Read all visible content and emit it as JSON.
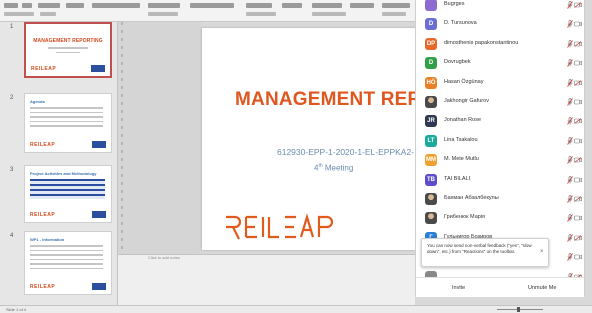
{
  "slides": [
    {
      "number": "1",
      "title": "MANAGEMENT REPORTING",
      "logo": "REILEAP"
    },
    {
      "number": "2",
      "heading": "Agenda",
      "logo": "REILEAP"
    },
    {
      "number": "3",
      "heading": "Project Activities and Methodology",
      "logo": "REILEAP"
    },
    {
      "number": "4",
      "heading": "WP1 - Information",
      "logo": "REILEAP"
    }
  ],
  "slide": {
    "title": "MANAGEMENT REP",
    "project_code": "612930-EPP-1-2020-1-EL-EPPKA2-",
    "meeting_num": "4",
    "meeting_sup": "th",
    "meeting_word": "Meeting",
    "logo": "REILEAP"
  },
  "notes": {
    "placeholder": "Click to add notes"
  },
  "participants": [
    {
      "name": "Bugrges",
      "initials": "",
      "avatar_color": "#8e6bd1",
      "mic": "muted",
      "cam": "off"
    },
    {
      "name": "D. Tursunova",
      "initials": "D",
      "avatar_color": "#6b6fd4",
      "mic": "muted",
      "cam": "off"
    },
    {
      "name": "dimosthenis papakonstantinou",
      "initials": "DP",
      "avatar_color": "#e8692a",
      "mic": "muted",
      "cam": "off"
    },
    {
      "name": "Dovrugbek",
      "initials": "D",
      "avatar_color": "#33a047",
      "mic": "muted",
      "cam": "off"
    },
    {
      "name": "Hasan Özgünay",
      "initials": "HÖ",
      "avatar_color": "#e8802a",
      "mic": "muted",
      "cam": "off"
    },
    {
      "name": "Jakhongir Gafurov",
      "initials": "",
      "avatar_color": "photo",
      "mic": "muted",
      "cam": "off"
    },
    {
      "name": "Jonathan Rose",
      "initials": "JR",
      "avatar_color": "#2f3a52",
      "mic": "muted",
      "cam": "off"
    },
    {
      "name": "Lina Tsakalou",
      "initials": "LT",
      "avatar_color": "#1aa99a",
      "mic": "muted",
      "cam": "off"
    },
    {
      "name": "M. Mete Mutlu",
      "initials": "MM",
      "avatar_color": "#f0a030",
      "mic": "muted",
      "cam": "off"
    },
    {
      "name": "TAI BILALI",
      "initials": "TB",
      "avatar_color": "#5a4fc8",
      "mic": "muted",
      "cam": "off"
    },
    {
      "name": "Бахман Абзалбекулы",
      "initials": "",
      "avatar_color": "photo",
      "mic": "muted",
      "cam": "off"
    },
    {
      "name": "Грибенюк Марія",
      "initials": "",
      "avatar_color": "photo",
      "mic": "muted",
      "cam": "off"
    },
    {
      "name": "Гульнигор Бозиров",
      "initials": "Г",
      "avatar_color": "#2b7fd4",
      "mic": "muted",
      "cam": "off"
    },
    {
      "name": "",
      "initials": "",
      "avatar_color": "#888888",
      "mic": "muted",
      "cam": "off"
    },
    {
      "name": "",
      "initials": "",
      "avatar_color": "#888888",
      "mic": "muted",
      "cam": "off"
    }
  ],
  "toast": {
    "text": "You can now send non-verbal feedback (\"yes\", \"slow down\", etc.) from \"Reactions\" on the toolbar.",
    "close": "×"
  },
  "footer": {
    "invite": "Invite",
    "unmute": "Unmute Me"
  },
  "status": {
    "left": "Slide 1 of 4"
  },
  "colors": {
    "accent_orange": "#e0571f",
    "mic_muted_red": "#d03030",
    "slide_subtitle_blue": "#6b8cb0"
  }
}
